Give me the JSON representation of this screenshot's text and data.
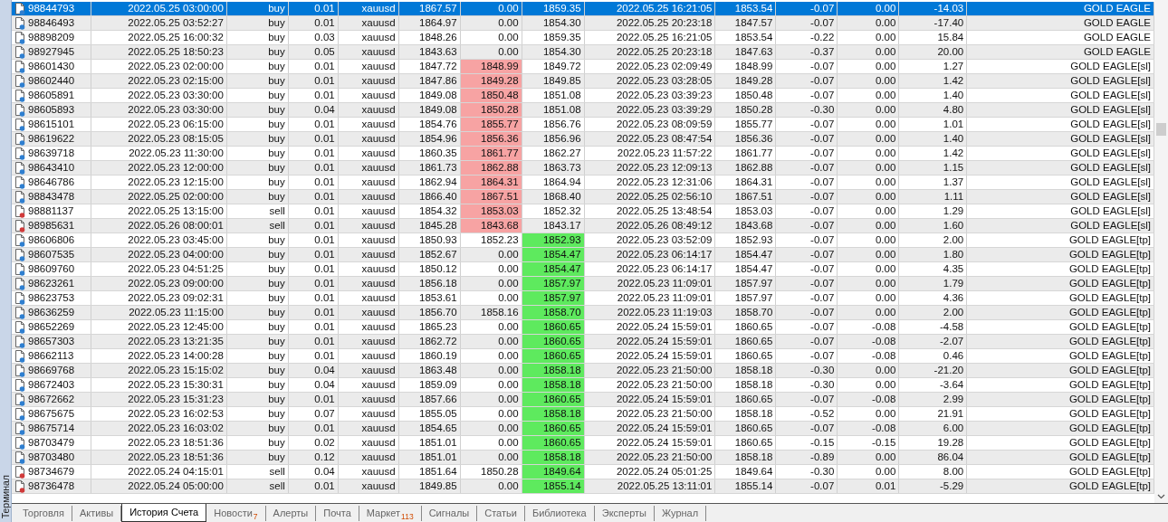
{
  "side_panel": {
    "title": "Терминал"
  },
  "rows": [
    {
      "cells": [
        "98844793",
        "2022.05.25 03:00:00",
        "buy",
        "0.01",
        "xauusd",
        "1867.57",
        "0.00",
        "1859.35",
        "2022.05.25 16:21:05",
        "1853.54",
        "-0.07",
        "0.00",
        "-14.03",
        "GOLD EAGLE"
      ],
      "sl_hit": false,
      "tp_hit": false,
      "color": "#2f7fd0",
      "selected": true
    },
    {
      "cells": [
        "98846493",
        "2022.05.25 03:52:27",
        "buy",
        "0.01",
        "xauusd",
        "1864.97",
        "0.00",
        "1854.30",
        "2022.05.25 20:23:18",
        "1847.57",
        "-0.07",
        "0.00",
        "-17.40",
        "GOLD EAGLE"
      ],
      "sl_hit": false,
      "tp_hit": false,
      "color": "#2f7fd0",
      "selected": false
    },
    {
      "cells": [
        "98898209",
        "2022.05.25 16:00:32",
        "buy",
        "0.03",
        "xauusd",
        "1848.26",
        "0.00",
        "1859.35",
        "2022.05.25 16:21:05",
        "1853.54",
        "-0.22",
        "0.00",
        "15.84",
        "GOLD EAGLE"
      ],
      "sl_hit": false,
      "tp_hit": false,
      "color": "#2f7fd0",
      "selected": false
    },
    {
      "cells": [
        "98927945",
        "2022.05.25 18:50:23",
        "buy",
        "0.05",
        "xauusd",
        "1843.63",
        "0.00",
        "1854.30",
        "2022.05.25 20:23:18",
        "1847.63",
        "-0.37",
        "0.00",
        "20.00",
        "GOLD EAGLE"
      ],
      "sl_hit": false,
      "tp_hit": false,
      "color": "#2f7fd0",
      "selected": false
    },
    {
      "cells": [
        "98601430",
        "2022.05.23 02:00:00",
        "buy",
        "0.01",
        "xauusd",
        "1847.72",
        "1848.99",
        "1849.72",
        "2022.05.23 02:09:49",
        "1848.99",
        "-0.07",
        "0.00",
        "1.27",
        "GOLD EAGLE[sl]"
      ],
      "sl_hit": true,
      "tp_hit": false,
      "color": "#2f7fd0",
      "selected": false
    },
    {
      "cells": [
        "98602440",
        "2022.05.23 02:15:00",
        "buy",
        "0.01",
        "xauusd",
        "1847.86",
        "1849.28",
        "1849.85",
        "2022.05.23 03:28:05",
        "1849.28",
        "-0.07",
        "0.00",
        "1.42",
        "GOLD EAGLE[sl]"
      ],
      "sl_hit": true,
      "tp_hit": false,
      "color": "#2f7fd0",
      "selected": false
    },
    {
      "cells": [
        "98605891",
        "2022.05.23 03:30:00",
        "buy",
        "0.01",
        "xauusd",
        "1849.08",
        "1850.48",
        "1851.08",
        "2022.05.23 03:39:23",
        "1850.48",
        "-0.07",
        "0.00",
        "1.40",
        "GOLD EAGLE[sl]"
      ],
      "sl_hit": true,
      "tp_hit": false,
      "color": "#2f7fd0",
      "selected": false
    },
    {
      "cells": [
        "98605893",
        "2022.05.23 03:30:00",
        "buy",
        "0.04",
        "xauusd",
        "1849.08",
        "1850.28",
        "1851.08",
        "2022.05.23 03:39:29",
        "1850.28",
        "-0.30",
        "0.00",
        "4.80",
        "GOLD EAGLE[sl]"
      ],
      "sl_hit": true,
      "tp_hit": false,
      "color": "#2f7fd0",
      "selected": false
    },
    {
      "cells": [
        "98615101",
        "2022.05.23 06:15:00",
        "buy",
        "0.01",
        "xauusd",
        "1854.76",
        "1855.77",
        "1856.76",
        "2022.05.23 08:09:59",
        "1855.77",
        "-0.07",
        "0.00",
        "1.01",
        "GOLD EAGLE[sl]"
      ],
      "sl_hit": true,
      "tp_hit": false,
      "color": "#2f7fd0",
      "selected": false
    },
    {
      "cells": [
        "98619622",
        "2022.05.23 08:15:05",
        "buy",
        "0.01",
        "xauusd",
        "1854.96",
        "1856.36",
        "1856.96",
        "2022.05.23 08:47:54",
        "1856.36",
        "-0.07",
        "0.00",
        "1.40",
        "GOLD EAGLE[sl]"
      ],
      "sl_hit": true,
      "tp_hit": false,
      "color": "#2f7fd0",
      "selected": false
    },
    {
      "cells": [
        "98639718",
        "2022.05.23 11:30:00",
        "buy",
        "0.01",
        "xauusd",
        "1860.35",
        "1861.77",
        "1862.27",
        "2022.05.23 11:57:22",
        "1861.77",
        "-0.07",
        "0.00",
        "1.42",
        "GOLD EAGLE[sl]"
      ],
      "sl_hit": true,
      "tp_hit": false,
      "color": "#2f7fd0",
      "selected": false
    },
    {
      "cells": [
        "98643410",
        "2022.05.23 12:00:00",
        "buy",
        "0.01",
        "xauusd",
        "1861.73",
        "1862.88",
        "1863.73",
        "2022.05.23 12:09:13",
        "1862.88",
        "-0.07",
        "0.00",
        "1.15",
        "GOLD EAGLE[sl]"
      ],
      "sl_hit": true,
      "tp_hit": false,
      "color": "#2f7fd0",
      "selected": false
    },
    {
      "cells": [
        "98646786",
        "2022.05.23 12:15:00",
        "buy",
        "0.01",
        "xauusd",
        "1862.94",
        "1864.31",
        "1864.94",
        "2022.05.23 12:31:06",
        "1864.31",
        "-0.07",
        "0.00",
        "1.37",
        "GOLD EAGLE[sl]"
      ],
      "sl_hit": true,
      "tp_hit": false,
      "color": "#2f7fd0",
      "selected": false
    },
    {
      "cells": [
        "98843478",
        "2022.05.25 02:00:00",
        "buy",
        "0.01",
        "xauusd",
        "1866.40",
        "1867.51",
        "1868.40",
        "2022.05.25 02:56:10",
        "1867.51",
        "-0.07",
        "0.00",
        "1.11",
        "GOLD EAGLE[sl]"
      ],
      "sl_hit": true,
      "tp_hit": false,
      "color": "#2f7fd0",
      "selected": false
    },
    {
      "cells": [
        "98881137",
        "2022.05.25 13:15:00",
        "sell",
        "0.01",
        "xauusd",
        "1854.32",
        "1853.03",
        "1852.32",
        "2022.05.25 13:48:54",
        "1853.03",
        "-0.07",
        "0.00",
        "1.29",
        "GOLD EAGLE[sl]"
      ],
      "sl_hit": true,
      "tp_hit": false,
      "color": "#d03a3a",
      "selected": false
    },
    {
      "cells": [
        "98985631",
        "2022.05.26 08:00:01",
        "sell",
        "0.01",
        "xauusd",
        "1845.28",
        "1843.68",
        "1843.17",
        "2022.05.26 08:49:12",
        "1843.68",
        "-0.07",
        "0.00",
        "1.60",
        "GOLD EAGLE[sl]"
      ],
      "sl_hit": true,
      "tp_hit": false,
      "color": "#d03a3a",
      "selected": false
    },
    {
      "cells": [
        "98606806",
        "2022.05.23 03:45:00",
        "buy",
        "0.01",
        "xauusd",
        "1850.93",
        "1852.23",
        "1852.93",
        "2022.05.23 03:52:09",
        "1852.93",
        "-0.07",
        "0.00",
        "2.00",
        "GOLD EAGLE[tp]"
      ],
      "sl_hit": false,
      "tp_hit": true,
      "color": "#2f7fd0",
      "selected": false
    },
    {
      "cells": [
        "98607535",
        "2022.05.23 04:00:00",
        "buy",
        "0.01",
        "xauusd",
        "1852.67",
        "0.00",
        "1854.47",
        "2022.05.23 06:14:17",
        "1854.47",
        "-0.07",
        "0.00",
        "1.80",
        "GOLD EAGLE[tp]"
      ],
      "sl_hit": false,
      "tp_hit": true,
      "color": "#2f7fd0",
      "selected": false
    },
    {
      "cells": [
        "98609760",
        "2022.05.23 04:51:25",
        "buy",
        "0.01",
        "xauusd",
        "1850.12",
        "0.00",
        "1854.47",
        "2022.05.23 06:14:17",
        "1854.47",
        "-0.07",
        "0.00",
        "4.35",
        "GOLD EAGLE[tp]"
      ],
      "sl_hit": false,
      "tp_hit": true,
      "color": "#2f7fd0",
      "selected": false
    },
    {
      "cells": [
        "98623261",
        "2022.05.23 09:00:00",
        "buy",
        "0.01",
        "xauusd",
        "1856.18",
        "0.00",
        "1857.97",
        "2022.05.23 11:09:01",
        "1857.97",
        "-0.07",
        "0.00",
        "1.79",
        "GOLD EAGLE[tp]"
      ],
      "sl_hit": false,
      "tp_hit": true,
      "color": "#2f7fd0",
      "selected": false
    },
    {
      "cells": [
        "98623753",
        "2022.05.23 09:02:31",
        "buy",
        "0.01",
        "xauusd",
        "1853.61",
        "0.00",
        "1857.97",
        "2022.05.23 11:09:01",
        "1857.97",
        "-0.07",
        "0.00",
        "4.36",
        "GOLD EAGLE[tp]"
      ],
      "sl_hit": false,
      "tp_hit": true,
      "color": "#2f7fd0",
      "selected": false
    },
    {
      "cells": [
        "98636259",
        "2022.05.23 11:15:00",
        "buy",
        "0.01",
        "xauusd",
        "1856.70",
        "1858.16",
        "1858.70",
        "2022.05.23 11:19:03",
        "1858.70",
        "-0.07",
        "0.00",
        "2.00",
        "GOLD EAGLE[tp]"
      ],
      "sl_hit": false,
      "tp_hit": true,
      "color": "#2f7fd0",
      "selected": false
    },
    {
      "cells": [
        "98652269",
        "2022.05.23 12:45:00",
        "buy",
        "0.01",
        "xauusd",
        "1865.23",
        "0.00",
        "1860.65",
        "2022.05.24 15:59:01",
        "1860.65",
        "-0.07",
        "-0.08",
        "-4.58",
        "GOLD EAGLE[tp]"
      ],
      "sl_hit": false,
      "tp_hit": true,
      "color": "#2f7fd0",
      "selected": false
    },
    {
      "cells": [
        "98657303",
        "2022.05.23 13:21:35",
        "buy",
        "0.01",
        "xauusd",
        "1862.72",
        "0.00",
        "1860.65",
        "2022.05.24 15:59:01",
        "1860.65",
        "-0.07",
        "-0.08",
        "-2.07",
        "GOLD EAGLE[tp]"
      ],
      "sl_hit": false,
      "tp_hit": true,
      "color": "#2f7fd0",
      "selected": false
    },
    {
      "cells": [
        "98662113",
        "2022.05.23 14:00:28",
        "buy",
        "0.01",
        "xauusd",
        "1860.19",
        "0.00",
        "1860.65",
        "2022.05.24 15:59:01",
        "1860.65",
        "-0.07",
        "-0.08",
        "0.46",
        "GOLD EAGLE[tp]"
      ],
      "sl_hit": false,
      "tp_hit": true,
      "color": "#2f7fd0",
      "selected": false
    },
    {
      "cells": [
        "98669768",
        "2022.05.23 15:15:02",
        "buy",
        "0.04",
        "xauusd",
        "1863.48",
        "0.00",
        "1858.18",
        "2022.05.23 21:50:00",
        "1858.18",
        "-0.30",
        "0.00",
        "-21.20",
        "GOLD EAGLE[tp]"
      ],
      "sl_hit": false,
      "tp_hit": true,
      "color": "#2f7fd0",
      "selected": false
    },
    {
      "cells": [
        "98672403",
        "2022.05.23 15:30:31",
        "buy",
        "0.04",
        "xauusd",
        "1859.09",
        "0.00",
        "1858.18",
        "2022.05.23 21:50:00",
        "1858.18",
        "-0.30",
        "0.00",
        "-3.64",
        "GOLD EAGLE[tp]"
      ],
      "sl_hit": false,
      "tp_hit": true,
      "color": "#2f7fd0",
      "selected": false
    },
    {
      "cells": [
        "98672662",
        "2022.05.23 15:31:23",
        "buy",
        "0.01",
        "xauusd",
        "1857.66",
        "0.00",
        "1860.65",
        "2022.05.24 15:59:01",
        "1860.65",
        "-0.07",
        "-0.08",
        "2.99",
        "GOLD EAGLE[tp]"
      ],
      "sl_hit": false,
      "tp_hit": true,
      "color": "#2f7fd0",
      "selected": false
    },
    {
      "cells": [
        "98675675",
        "2022.05.23 16:02:53",
        "buy",
        "0.07",
        "xauusd",
        "1855.05",
        "0.00",
        "1858.18",
        "2022.05.23 21:50:00",
        "1858.18",
        "-0.52",
        "0.00",
        "21.91",
        "GOLD EAGLE[tp]"
      ],
      "sl_hit": false,
      "tp_hit": true,
      "color": "#2f7fd0",
      "selected": false
    },
    {
      "cells": [
        "98675714",
        "2022.05.23 16:03:02",
        "buy",
        "0.01",
        "xauusd",
        "1854.65",
        "0.00",
        "1860.65",
        "2022.05.24 15:59:01",
        "1860.65",
        "-0.07",
        "-0.08",
        "6.00",
        "GOLD EAGLE[tp]"
      ],
      "sl_hit": false,
      "tp_hit": true,
      "color": "#2f7fd0",
      "selected": false
    },
    {
      "cells": [
        "98703479",
        "2022.05.23 18:51:36",
        "buy",
        "0.02",
        "xauusd",
        "1851.01",
        "0.00",
        "1860.65",
        "2022.05.24 15:59:01",
        "1860.65",
        "-0.15",
        "-0.15",
        "19.28",
        "GOLD EAGLE[tp]"
      ],
      "sl_hit": false,
      "tp_hit": true,
      "color": "#2f7fd0",
      "selected": false
    },
    {
      "cells": [
        "98703480",
        "2022.05.23 18:51:36",
        "buy",
        "0.12",
        "xauusd",
        "1851.01",
        "0.00",
        "1858.18",
        "2022.05.23 21:50:00",
        "1858.18",
        "-0.89",
        "0.00",
        "86.04",
        "GOLD EAGLE[tp]"
      ],
      "sl_hit": false,
      "tp_hit": true,
      "color": "#2f7fd0",
      "selected": false
    },
    {
      "cells": [
        "98734679",
        "2022.05.24 04:15:01",
        "sell",
        "0.04",
        "xauusd",
        "1851.64",
        "1850.28",
        "1849.64",
        "2022.05.24 05:01:25",
        "1849.64",
        "-0.30",
        "0.00",
        "8.00",
        "GOLD EAGLE[tp]"
      ],
      "sl_hit": false,
      "tp_hit": true,
      "color": "#d03a3a",
      "selected": false
    },
    {
      "cells": [
        "98736478",
        "2022.05.24 05:00:00",
        "sell",
        "0.01",
        "xauusd",
        "1849.85",
        "0.00",
        "1855.14",
        "2022.05.25 13:11:01",
        "1855.14",
        "-0.07",
        "0.01",
        "-5.29",
        "GOLD EAGLE[tp]"
      ],
      "sl_hit": false,
      "tp_hit": true,
      "color": "#d03a3a",
      "selected": false
    }
  ],
  "tabs": [
    {
      "label": "Торговля",
      "selected": false
    },
    {
      "label": "Активы",
      "selected": false
    },
    {
      "label": "История Счета",
      "selected": true
    },
    {
      "label": "Новости",
      "badge": "7",
      "selected": false
    },
    {
      "label": "Алерты",
      "selected": false
    },
    {
      "label": "Почта",
      "selected": false
    },
    {
      "label": "Маркет",
      "badge": "113",
      "selected": false
    },
    {
      "label": "Сигналы",
      "selected": false
    },
    {
      "label": "Статьи",
      "selected": false
    },
    {
      "label": "Библиотека",
      "selected": false
    },
    {
      "label": "Эксперты",
      "selected": false
    },
    {
      "label": "Журнал",
      "selected": false
    }
  ]
}
